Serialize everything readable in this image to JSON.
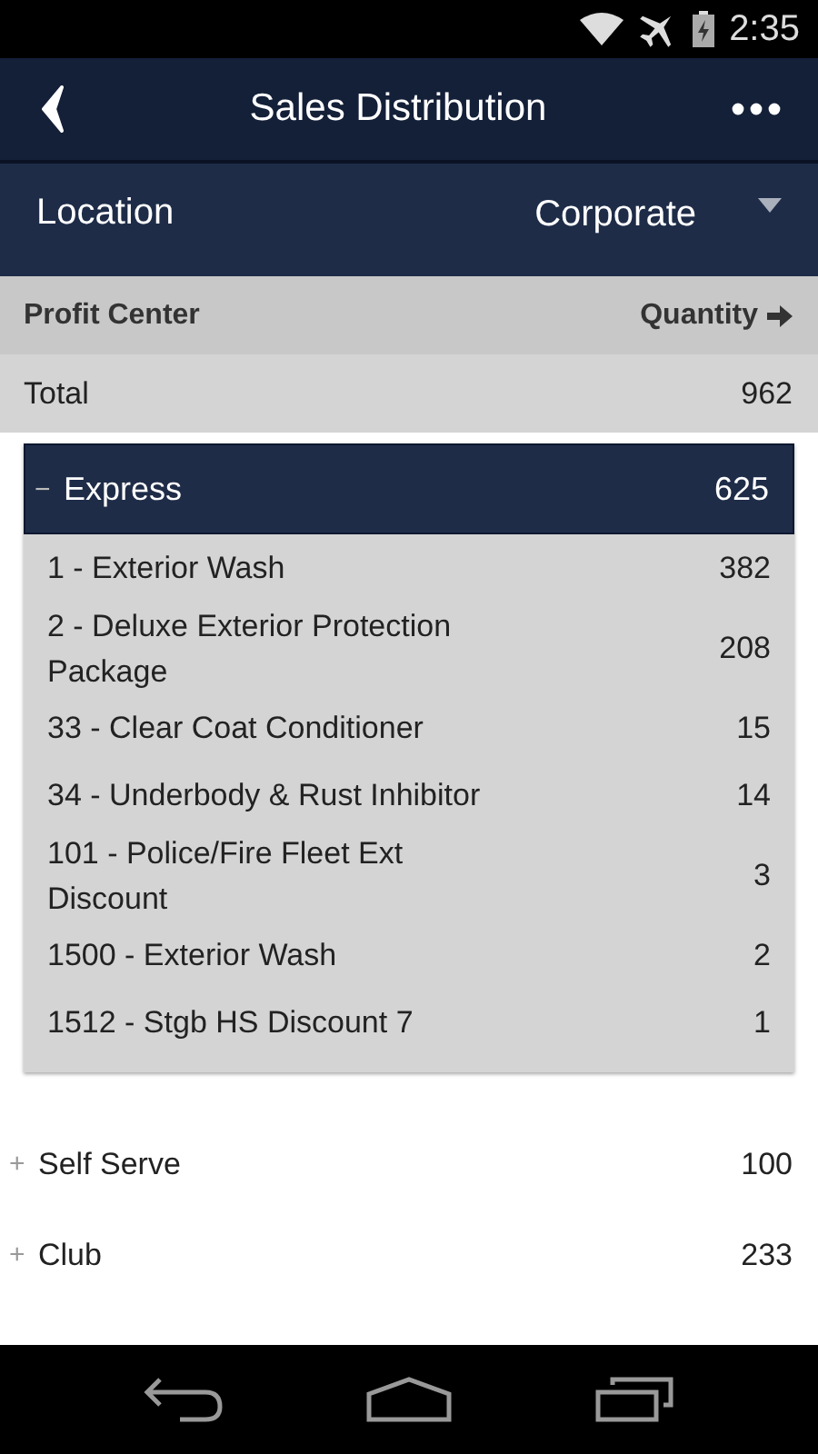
{
  "status_bar": {
    "time": "2:35"
  },
  "app_bar": {
    "title": "Sales Distribution"
  },
  "filter": {
    "label": "Location",
    "value": "Corporate"
  },
  "table": {
    "columns": [
      "Profit Center",
      "Quantity"
    ],
    "total": {
      "label": "Total",
      "value": "962"
    },
    "groups": [
      {
        "toggle": "−",
        "name": "Express",
        "value": "625",
        "expanded": true,
        "children": [
          {
            "name": "1 - Exterior Wash",
            "value": "382"
          },
          {
            "name": "2 - Deluxe Exterior Protection Package",
            "value": "208"
          },
          {
            "name": "33 - Clear Coat Conditioner",
            "value": "15"
          },
          {
            "name": "34 - Underbody & Rust Inhibitor",
            "value": "14"
          },
          {
            "name": "101 - Police/Fire Fleet Ext Discount",
            "value": "3"
          },
          {
            "name": "1500 - Exterior Wash",
            "value": "2"
          },
          {
            "name": "1512 - Stgb HS Discount 7",
            "value": "1"
          }
        ]
      },
      {
        "toggle": "+",
        "name": "Self Serve",
        "value": "100",
        "expanded": false
      },
      {
        "toggle": "+",
        "name": "Club",
        "value": "233",
        "expanded": false
      }
    ]
  }
}
